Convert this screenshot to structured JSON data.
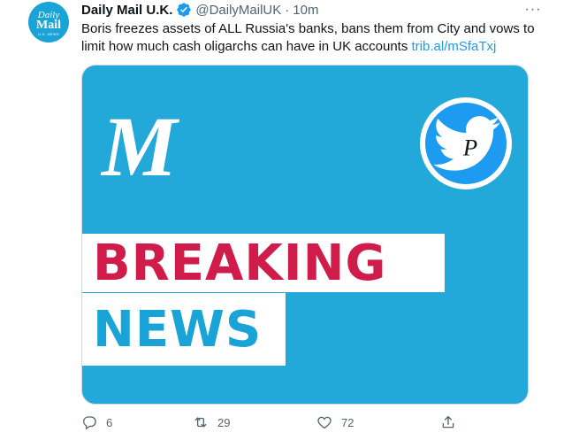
{
  "account": {
    "avatar_line1": "Daily",
    "avatar_line2": "Mail",
    "avatar_line3": "U.K. NEWS",
    "name": "Daily Mail U.K.",
    "handle": "@DailyMailUK",
    "separator": "·",
    "time": "10m",
    "verified": true
  },
  "tweet": {
    "text": "Boris freezes assets of ALL Russia's banks, bans them from City and vows to limit how much cash oligarchs can have in UK accounts ",
    "link": "trib.al/mSfaTxj"
  },
  "media": {
    "logo_letter": "M",
    "line1": "BREAKING",
    "line2": "NEWS",
    "badge_letter": "P"
  },
  "actions": {
    "reply_count": "6",
    "retweet_count": "29",
    "like_count": "72"
  },
  "more_label": "···",
  "colors": {
    "brand_blue": "#22a9d9",
    "breaking_red": "#d01c4a",
    "link_blue": "#1d9bf0",
    "muted": "#536471"
  }
}
